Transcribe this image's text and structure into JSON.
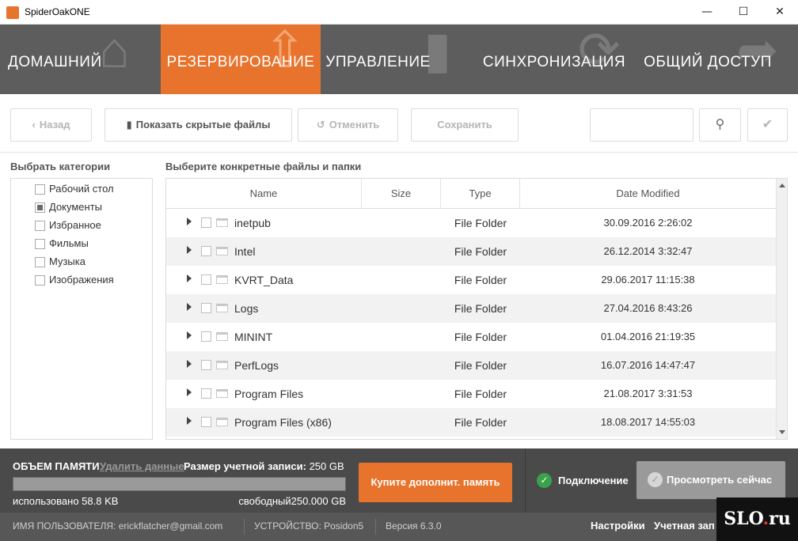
{
  "window": {
    "title": "SpiderOakONE",
    "icons": {
      "minimize": "minimize-icon",
      "maximize": "maximize-icon",
      "close": "close-icon"
    }
  },
  "nav": {
    "tabs": [
      {
        "label": "ДОМАШНИЙ",
        "icon": "home-icon",
        "active": false
      },
      {
        "label": "РЕЗЕРВИРОВАНИЕ",
        "icon": "upload-icon",
        "active": true
      },
      {
        "label": "УПРАВЛЕНИЕ",
        "icon": "document-icon",
        "active": false
      },
      {
        "label": "СИНХРОНИЗАЦИЯ",
        "icon": "sync-icon",
        "active": false
      },
      {
        "label": "ОБЩИЙ ДОСТУП",
        "icon": "share-icon",
        "active": false
      }
    ],
    "accent_color": "#e8732c"
  },
  "toolbar": {
    "back_label": "Назад",
    "show_hidden_label": "Показать скрытые файлы",
    "cancel_label": "Отменить",
    "save_label": "Сохранить",
    "search_value": ""
  },
  "categories": {
    "heading": "Выбрать категории",
    "items": [
      {
        "label": "Рабочий стол",
        "state": "unchecked"
      },
      {
        "label": "Документы",
        "state": "partial"
      },
      {
        "label": "Избранное",
        "state": "unchecked"
      },
      {
        "label": "Фильмы",
        "state": "unchecked"
      },
      {
        "label": "Музыка",
        "state": "unchecked"
      },
      {
        "label": "Изображения",
        "state": "unchecked"
      }
    ]
  },
  "files": {
    "heading": "Выберите конкретные файлы и папки",
    "columns": [
      "Name",
      "Size",
      "Type",
      "Date Modified"
    ],
    "rows": [
      {
        "name": "inetpub",
        "size": "",
        "type": "File Folder",
        "date": "30.09.2016 2:26:02"
      },
      {
        "name": "Intel",
        "size": "",
        "type": "File Folder",
        "date": "26.12.2014 3:32:47"
      },
      {
        "name": "KVRT_Data",
        "size": "",
        "type": "File Folder",
        "date": "29.06.2017 11:15:38"
      },
      {
        "name": "Logs",
        "size": "",
        "type": "File Folder",
        "date": "27.04.2016 8:43:26"
      },
      {
        "name": "MININT",
        "size": "",
        "type": "File Folder",
        "date": "01.04.2016 21:19:35"
      },
      {
        "name": "PerfLogs",
        "size": "",
        "type": "File Folder",
        "date": "16.07.2016 14:47:47"
      },
      {
        "name": "Program Files",
        "size": "",
        "type": "File Folder",
        "date": "21.08.2017 3:31:53"
      },
      {
        "name": "Program Files (x86)",
        "size": "",
        "type": "File Folder",
        "date": "18.08.2017 14:55:03"
      }
    ]
  },
  "storage": {
    "title": "ОБЪЕМ ПАМЯТИ",
    "delete_link": "Удалить данные",
    "account_size_label": "Размер учетной записи:",
    "account_size_value": "250 GB",
    "used_text": "использовано 58.8 KB",
    "free_text": "свободный250.000 GB",
    "used_fraction": 0.0,
    "buy_label": "Купите дополнит. память"
  },
  "status": {
    "connection_label": "Подключение",
    "connection_color": "#3aa24a",
    "view_now_label": "Просмотреть сейчас"
  },
  "footer": {
    "user": "ИМЯ ПОЛЬЗОВАТЕЛЯ: erickflatcher@gmail.com",
    "device": "УСТРОЙСТВО: Posidon5",
    "version": "Версия 6.3.0",
    "settings_label": "Настройки",
    "account_label": "Учетная зап"
  },
  "watermark": {
    "text_main": "SLO",
    "text_dot": ".",
    "text_end": "ru"
  }
}
